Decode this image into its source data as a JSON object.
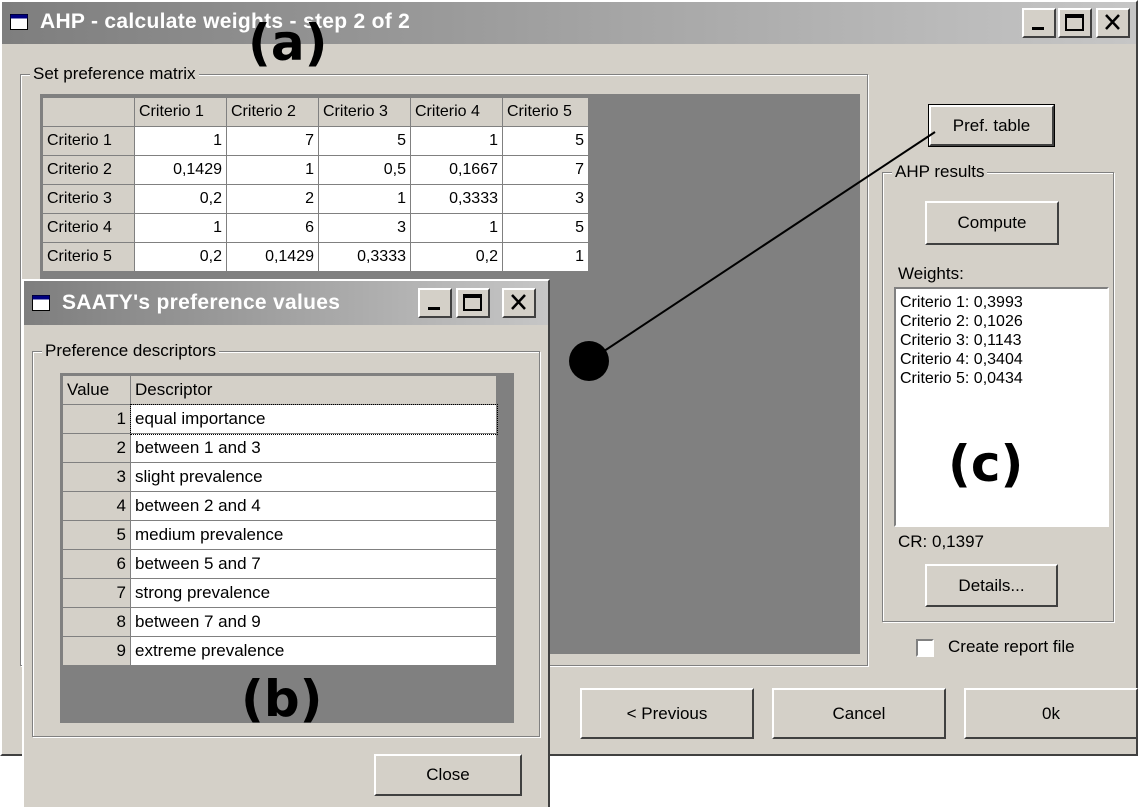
{
  "main_window": {
    "title": "AHP - calculate weights - step 2 of 2",
    "matrix_group_label": "Set preference matrix",
    "matrix": {
      "columns": [
        "Criterio 1",
        "Criterio 2",
        "Criterio 3",
        "Criterio 4",
        "Criterio 5"
      ],
      "rows": [
        {
          "name": "Criterio 1",
          "values": [
            "1",
            "7",
            "5",
            "1",
            "5"
          ]
        },
        {
          "name": "Criterio 2",
          "values": [
            "0,1429",
            "1",
            "0,5",
            "0,1667",
            "7"
          ]
        },
        {
          "name": "Criterio 3",
          "values": [
            "0,2",
            "2",
            "1",
            "0,3333",
            "3"
          ]
        },
        {
          "name": "Criterio 4",
          "values": [
            "1",
            "6",
            "3",
            "1",
            "5"
          ]
        },
        {
          "name": "Criterio 5",
          "values": [
            "0,2",
            "0,1429",
            "0,3333",
            "0,2",
            "1"
          ]
        }
      ]
    },
    "pref_table_button": "Pref. table",
    "results_group_label": "AHP results",
    "compute_button": "Compute",
    "weights_label": "Weights:",
    "weights": [
      "Criterio 1: 0,3993",
      "Criterio 2: 0,1026",
      "Criterio 3: 0,1143",
      "Criterio 4: 0,3404",
      "Criterio 5: 0,0434"
    ],
    "cr_text": "CR: 0,1397",
    "details_button": "Details...",
    "create_report_label": "Create report file",
    "create_report_checked": false,
    "previous_button": "< Previous",
    "cancel_button": "Cancel",
    "ok_button": "0k"
  },
  "saaty_window": {
    "title": "SAATY's preference values",
    "group_label": "Preference descriptors",
    "columns": [
      "Value",
      "Descriptor"
    ],
    "rows": [
      {
        "value": "1",
        "descriptor": "equal importance"
      },
      {
        "value": "2",
        "descriptor": "between 1 and 3"
      },
      {
        "value": "3",
        "descriptor": "slight prevalence"
      },
      {
        "value": "4",
        "descriptor": "between 2 and 4"
      },
      {
        "value": "5",
        "descriptor": "medium prevalence"
      },
      {
        "value": "6",
        "descriptor": "between 5 and 7"
      },
      {
        "value": "7",
        "descriptor": "strong prevalence"
      },
      {
        "value": "8",
        "descriptor": "between 7 and 9"
      },
      {
        "value": "9",
        "descriptor": "extreme prevalence"
      }
    ],
    "close_button": "Close"
  },
  "annotations": {
    "a": "(a)",
    "b": "(b)",
    "c": "(c)"
  },
  "colors": {
    "window_face": "#d4d0c8",
    "dark_area": "#808080",
    "title_gradient_start": "#7e7e7e",
    "title_gradient_end": "#c6c6c6"
  }
}
